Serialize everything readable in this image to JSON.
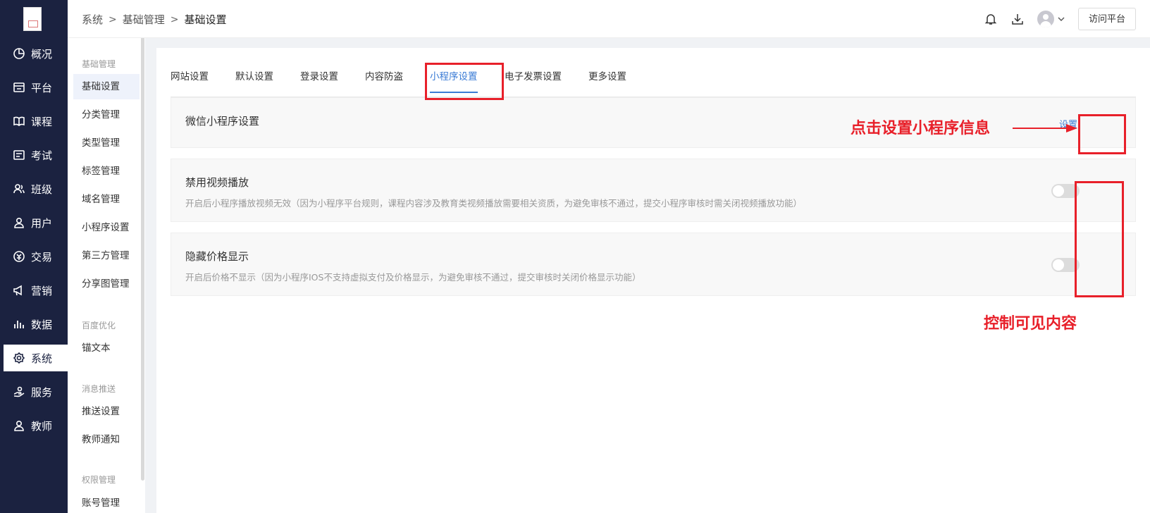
{
  "nav": {
    "items": [
      {
        "label": "概况",
        "icon": "pie-chart-icon"
      },
      {
        "label": "平台",
        "icon": "store-icon"
      },
      {
        "label": "课程",
        "icon": "book-icon"
      },
      {
        "label": "考试",
        "icon": "exam-icon"
      },
      {
        "label": "班级",
        "icon": "group-icon"
      },
      {
        "label": "用户",
        "icon": "user-icon"
      },
      {
        "label": "交易",
        "icon": "money-icon"
      },
      {
        "label": "营销",
        "icon": "megaphone-icon"
      },
      {
        "label": "数据",
        "icon": "bar-chart-icon"
      },
      {
        "label": "系统",
        "icon": "gear-icon",
        "active": true
      },
      {
        "label": "服务",
        "icon": "service-icon"
      },
      {
        "label": "教师",
        "icon": "teacher-icon"
      }
    ]
  },
  "submenu": {
    "groups": [
      {
        "title": "基础管理",
        "items": [
          "基础设置",
          "分类管理",
          "类型管理",
          "标签管理",
          "域名管理",
          "小程序设置",
          "第三方管理",
          "分享图管理"
        ]
      },
      {
        "title": "百度优化",
        "items": [
          "锚文本"
        ]
      },
      {
        "title": "消息推送",
        "items": [
          "推送设置",
          "教师通知"
        ]
      },
      {
        "title": "权限管理",
        "items": [
          "账号管理"
        ]
      }
    ]
  },
  "header": {
    "breadcrumb": [
      "系统",
      "基础管理",
      "基础设置"
    ],
    "visit_button": "访问平台"
  },
  "tabs": [
    "网站设置",
    "默认设置",
    "登录设置",
    "内容防盗",
    "小程序设置",
    "电子发票设置",
    "更多设置"
  ],
  "active_tab": "小程序设置",
  "cards": {
    "wechat": {
      "title": "微信小程序设置",
      "action": "设置"
    },
    "video": {
      "title": "禁用视频播放",
      "desc": "开启后小程序播放视频无效（因为小程序平台规则，课程内容涉及教育类视频播放需要相关资质，为避免审核不通过，提交小程序审核时需关闭视频播放功能）",
      "enabled": false
    },
    "price": {
      "title": "隐藏价格显示",
      "desc": "开启后价格不显示（因为小程序IOS不支持虚拟支付及价格显示，为避免审核不通过，提交审核时关闭价格显示功能）",
      "enabled": false
    }
  },
  "annotations": {
    "set_info": "点击设置小程序信息",
    "control": "控制可见内容",
    "color": "#e8202a"
  }
}
